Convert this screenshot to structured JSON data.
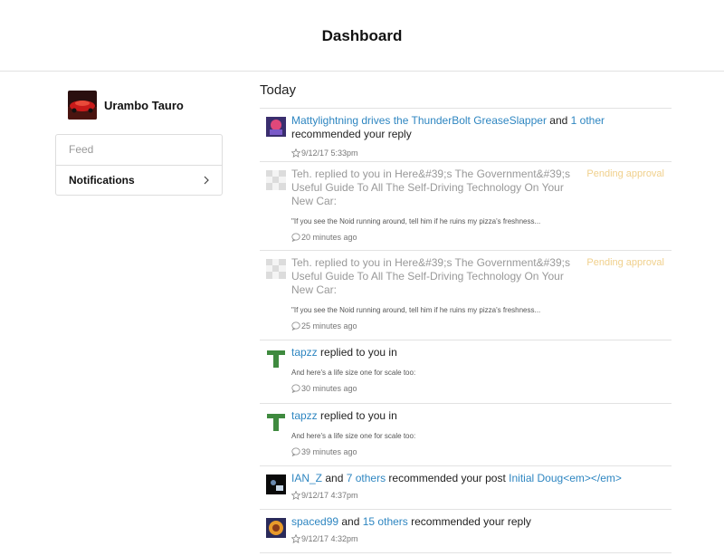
{
  "header": {
    "title": "Dashboard"
  },
  "profile": {
    "name": "Urambo Tauro"
  },
  "sidenav": {
    "feed_label": "Feed",
    "notifications_label": "Notifications"
  },
  "main": {
    "section_title": "Today",
    "notifications": [
      {
        "actor": "Mattylightning drives the ThunderBolt GreaseSlapper",
        "connector": " and ",
        "others": "1 other",
        "action": " recommended your reply",
        "time": "9/12/17 5:33pm",
        "icon": "star-icon"
      },
      {
        "text": "Teh. replied to you in Here&#39;s The Government&#39;s Useful Guide To All The Self-Driving Technology On Your New Car:",
        "status": "Pending approval",
        "excerpt": "\"If you see the Noid running around, tell him if he ruins my pizza's freshness...",
        "time": "20 minutes ago",
        "icon": "comment-icon"
      },
      {
        "text": "Teh. replied to you in Here&#39;s The Government&#39;s Useful Guide To All The Self-Driving Technology On Your New Car:",
        "status": "Pending approval",
        "excerpt": "\"If you see the Noid running around, tell him if he ruins my pizza's freshness...",
        "time": "25 minutes ago",
        "icon": "comment-icon"
      },
      {
        "actor": "tapzz",
        "action": " replied to you in",
        "excerpt": "And here's a life size one for scale too:",
        "time": "30 minutes ago",
        "icon": "comment-icon"
      },
      {
        "actor": "tapzz",
        "action": " replied to you in",
        "excerpt": "And here's a life size one for scale too:",
        "time": "39 minutes ago",
        "icon": "comment-icon"
      },
      {
        "actor": "IAN_Z",
        "connector": " and ",
        "others": "7 others",
        "action": " recommended your post ",
        "post": "Initial Doug<em></em>",
        "time": "9/12/17 4:37pm",
        "icon": "star-icon"
      },
      {
        "actor": "spaced99",
        "connector": " and ",
        "others": "15 others",
        "action": " recommended your reply",
        "time": "9/12/17 4:32pm",
        "icon": "star-icon"
      }
    ]
  },
  "colors": {
    "link": "#2e86c1",
    "pending": "#f0d08c"
  }
}
